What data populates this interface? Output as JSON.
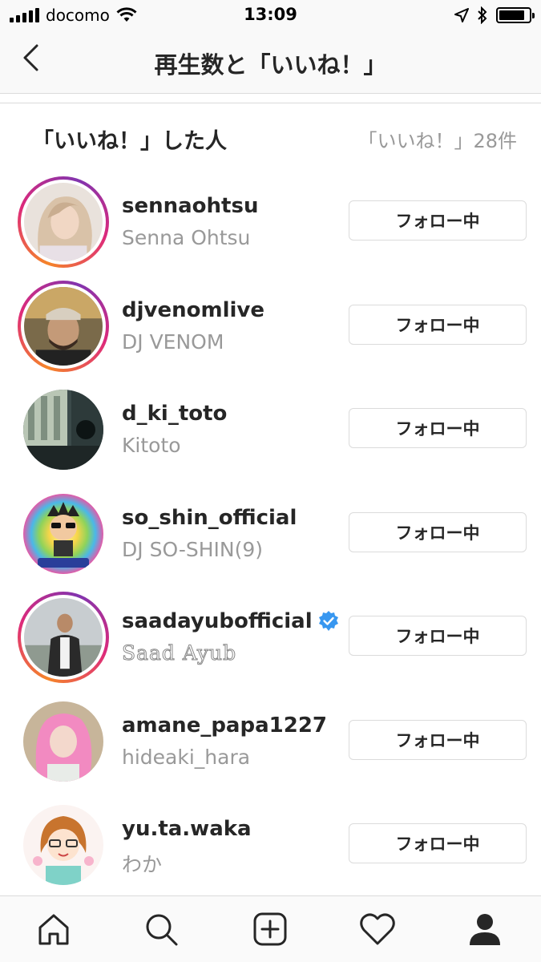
{
  "status_bar": {
    "carrier": "docomo",
    "time": "13:09",
    "battery_level": 0.85
  },
  "header": {
    "title": "再生数と「いいね！」",
    "back_icon": "chevron-left-icon"
  },
  "section": {
    "title": "「いいね！」した人",
    "count_text": "「いいね！」28件"
  },
  "users": [
    {
      "username": "sennaohtsu",
      "full_name": "Senna  Ohtsu",
      "button": "フォロー中",
      "story_ring": true,
      "verified": false
    },
    {
      "username": "djvenomlive",
      "full_name": "DJ VENOM",
      "button": "フォロー中",
      "story_ring": true,
      "verified": false
    },
    {
      "username": "d_ki_toto",
      "full_name": "Kitoto",
      "button": "フォロー中",
      "story_ring": false,
      "verified": false
    },
    {
      "username": "so_shin_official",
      "full_name": "DJ SO-SHIN(9)",
      "button": "フォロー中",
      "story_ring": false,
      "verified": false
    },
    {
      "username": "saadayubofficial",
      "full_name": "Saad Ayub",
      "button": "フォロー中",
      "story_ring": true,
      "verified": true
    },
    {
      "username": "amane_papa1227",
      "full_name": "hideaki_hara",
      "button": "フォロー中",
      "story_ring": false,
      "verified": false
    },
    {
      "username": "yu.ta.waka",
      "full_name": "わか",
      "button": "フォロー中",
      "story_ring": false,
      "verified": false
    }
  ],
  "tab_bar": {
    "tabs": [
      "home-icon",
      "search-icon",
      "add-post-icon",
      "heart-icon",
      "profile-icon"
    ]
  },
  "colors": {
    "accent_blue": "#3897f0",
    "border": "#dbdbdb",
    "secondary_text": "#999999"
  }
}
